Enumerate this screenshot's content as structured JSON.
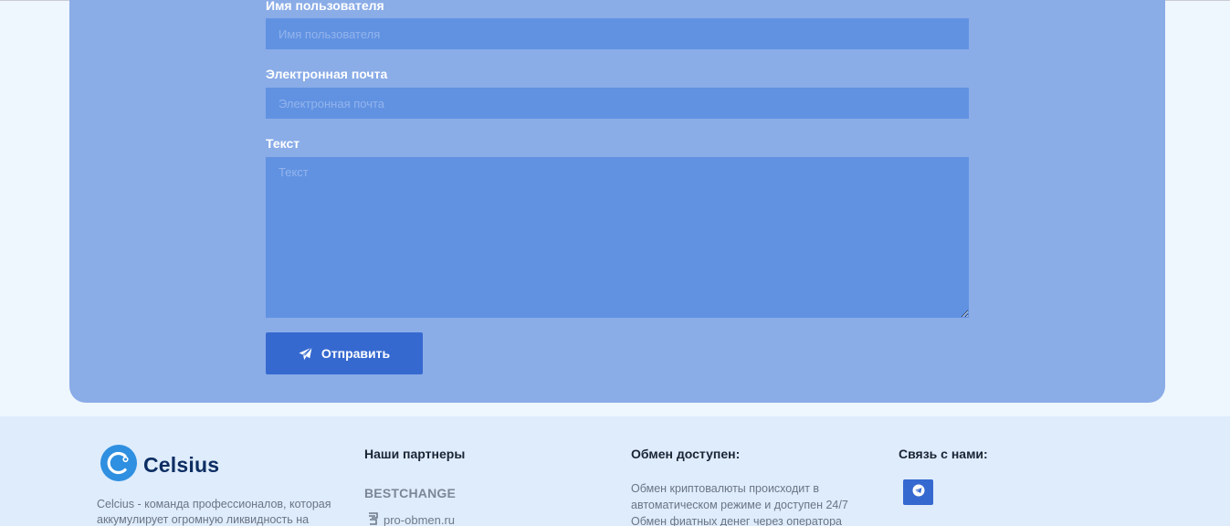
{
  "form": {
    "username_label": "Имя пользователя",
    "username_placeholder": "Имя пользователя",
    "email_label": "Электронная почта",
    "email_placeholder": "Электронная почта",
    "text_label": "Текст",
    "text_placeholder": "Текст",
    "submit_label": "Отправить"
  },
  "footer": {
    "brand": "Celsius",
    "about": "Celcius - команда профессионалов, которая аккумулирует огромную ликвидность на",
    "partners_title": "Наши партнеры",
    "partners": [
      "BESTCHANGE",
      "pro-obmen.ru"
    ],
    "exchange_title": "Обмен доступен:",
    "exchange_text": "Обмен криптовалюты происходит в автоматическом режиме и доступен 24/7 Обмен фиатных денег через оператора",
    "contact_title": "Связь с нами:"
  },
  "colors": {
    "card": "#8aace7",
    "field": "#6192e2",
    "button": "#3669d0",
    "footer": "#deecfc",
    "brand": "#0d2d63"
  },
  "icons": [
    "send-icon",
    "celsius-logo-icon",
    "pro-obmen-logo-icon",
    "telegram-icon"
  ]
}
